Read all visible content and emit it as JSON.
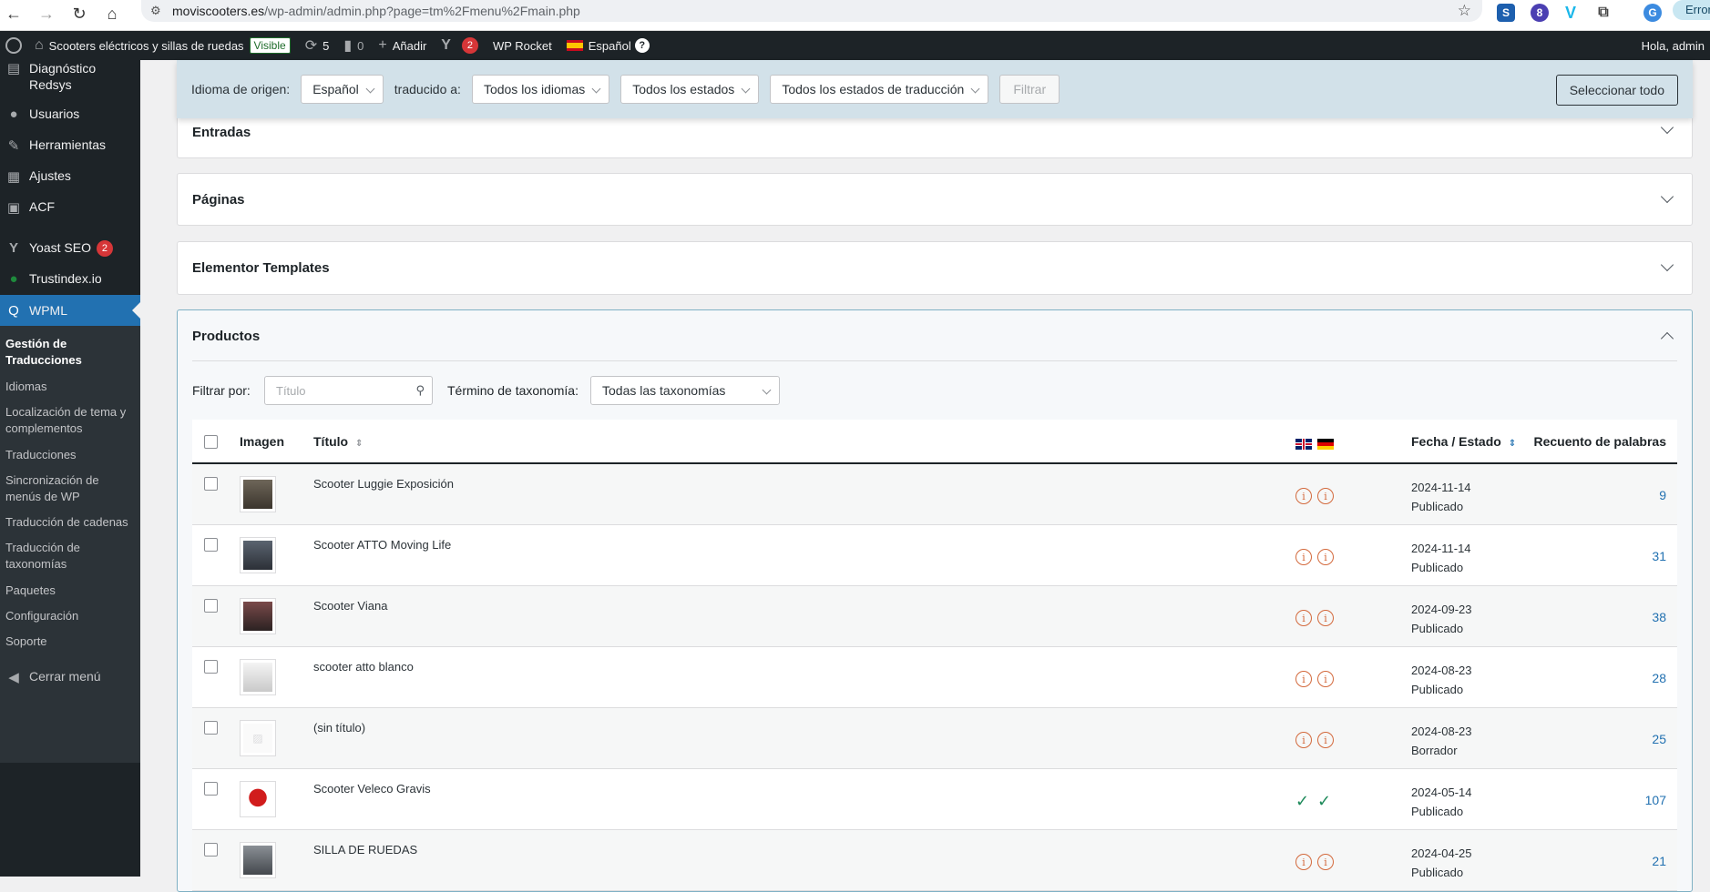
{
  "browser": {
    "url_host": "moviscooters.es",
    "url_path": "/wp-admin/admin.php?page=tm%2Fmenu%2Fmain.php",
    "error_pill": "Error"
  },
  "adminbar": {
    "site_name": "Scooters eléctricos y sillas de ruedas",
    "visible_badge": "Visible",
    "updates_count": "5",
    "comments_count": "0",
    "add_label": "Añadir",
    "yoast_count": "2",
    "wp_rocket": "WP Rocket",
    "language": "Español",
    "greeting": "Hola, admin"
  },
  "sidebar": {
    "items": [
      {
        "label": "Diagnóstico Redsys",
        "icon": "table-icon"
      },
      {
        "label": "Usuarios",
        "icon": "user-icon"
      },
      {
        "label": "Herramientas",
        "icon": "wrench-icon"
      },
      {
        "label": "Ajustes",
        "icon": "sliders-icon"
      },
      {
        "label": "ACF",
        "icon": "grid-icon"
      },
      {
        "label": "Yoast SEO",
        "icon": "yoast-icon",
        "count": "2"
      },
      {
        "label": "Trustindex.io",
        "icon": "check-circle-icon"
      },
      {
        "label": "WPML",
        "icon": "wpml-icon"
      }
    ],
    "submenu": [
      "Gestión de Traducciones",
      "Idiomas",
      "Localización de tema y complementos",
      "Traducciones",
      "Sincronización de menús de WP",
      "Traducción de cadenas",
      "Traducción de taxonomías",
      "Paquetes",
      "Configuración",
      "Soporte"
    ],
    "collapse": "Cerrar menú"
  },
  "filters": {
    "source_label": "Idioma de origen:",
    "source_value": "Español",
    "translated_label": "traducido a:",
    "languages_value": "Todos los idiomas",
    "states_value": "Todos los estados",
    "translation_states_value": "Todos los estados de traducción",
    "filter_button": "Filtrar",
    "select_all": "Seleccionar todo"
  },
  "sections": {
    "entradas": "Entradas",
    "paginas": "Páginas",
    "elementor": "Elementor Templates",
    "productos": "Productos"
  },
  "products": {
    "filter_by_label": "Filtrar por:",
    "search_placeholder": "Título",
    "taxonomy_label": "Término de taxonomía:",
    "taxonomy_value": "Todas las taxonomías",
    "columns": {
      "image": "Imagen",
      "title": "Título",
      "date_status": "Fecha / Estado",
      "word_count": "Recuento de palabras"
    },
    "rows": [
      {
        "title": "Scooter Luggie Exposición",
        "date": "2024-11-14",
        "status": "Publicado",
        "count": "9",
        "translated": false
      },
      {
        "title": "Scooter ATTO Moving Life",
        "date": "2024-11-14",
        "status": "Publicado",
        "count": "31",
        "translated": false
      },
      {
        "title": "Scooter Viana",
        "date": "2024-09-23",
        "status": "Publicado",
        "count": "38",
        "translated": false
      },
      {
        "title": "scooter atto blanco",
        "date": "2024-08-23",
        "status": "Publicado",
        "count": "28",
        "translated": false
      },
      {
        "title": "(sin título)",
        "date": "2024-08-23",
        "status": "Borrador",
        "count": "25",
        "translated": false
      },
      {
        "title": "Scooter Veleco Gravis",
        "date": "2024-05-14",
        "status": "Publicado",
        "count": "107",
        "translated": true
      },
      {
        "title": "SILLA DE RUEDAS",
        "date": "2024-04-25",
        "status": "Publicado",
        "count": "21",
        "translated": false
      }
    ]
  }
}
